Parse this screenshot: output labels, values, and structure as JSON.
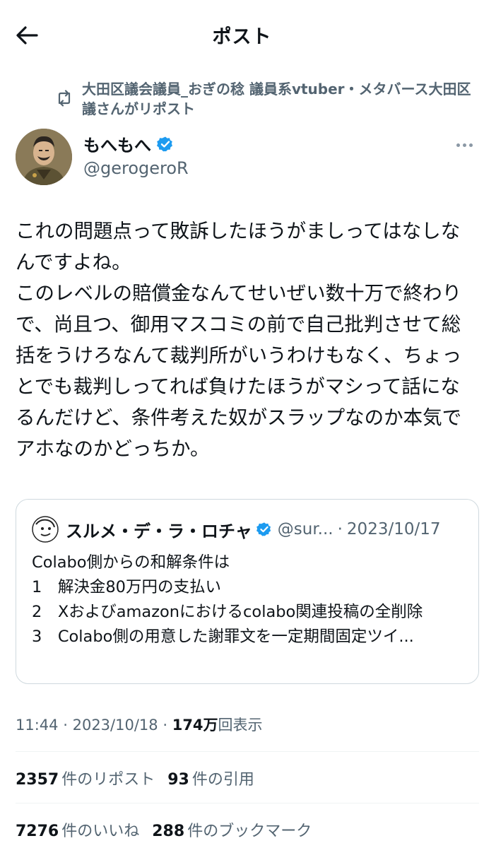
{
  "header": {
    "title": "ポスト"
  },
  "repost": {
    "text": "大田区議会議員_おぎの稔 議員系vtuber・メタバース大田区議さんがリポスト"
  },
  "author": {
    "name": "もへもへ",
    "handle": "@gerogeroR"
  },
  "tweet": {
    "text": "これの問題点って敗訴したほうがましってはなしなんですよね。\nこのレベルの賠償金なんてせいぜい数十万で終わりで、尚且つ、御用マスコミの前で自己批判させて総括をうけろなんて裁判所がいうわけもなく、ちょっとでも裁判しってれば負けたほうがマシって話になるんだけど、条件考えた奴がスラップなのか本気でアホなのかどっちか。"
  },
  "quote": {
    "name": "スルメ・デ・ラ・ロチャ",
    "handle": "@sur...",
    "separator": "·",
    "date": "2023/10/17",
    "lines": [
      "Colabo側からの和解条件は",
      "1　解決金80万円の支払い",
      "2　Xおよびamazonにおけるcolabo関連投稿の全削除",
      "3　Colabo側の用意した謝罪文を一定期間固定ツイ..."
    ]
  },
  "meta": {
    "time": "11:44",
    "sep": "·",
    "date": "2023/10/18",
    "sep2": "·",
    "views_count": "174万",
    "views_label": "回表示"
  },
  "stats": {
    "reposts_count": "2357",
    "reposts_label": "件のリポスト",
    "quotes_count": "93",
    "quotes_label": "件の引用",
    "likes_count": "7276",
    "likes_label": "件のいいね",
    "bookmarks_count": "288",
    "bookmarks_label": "件のブックマーク"
  },
  "colors": {
    "text": "#0f1419",
    "secondary": "#536471",
    "verified": "#1d9bf0",
    "border": "#cfd9de"
  },
  "icons": [
    "back-arrow-icon",
    "repost-icon",
    "verified-badge-icon",
    "more-icon"
  ]
}
